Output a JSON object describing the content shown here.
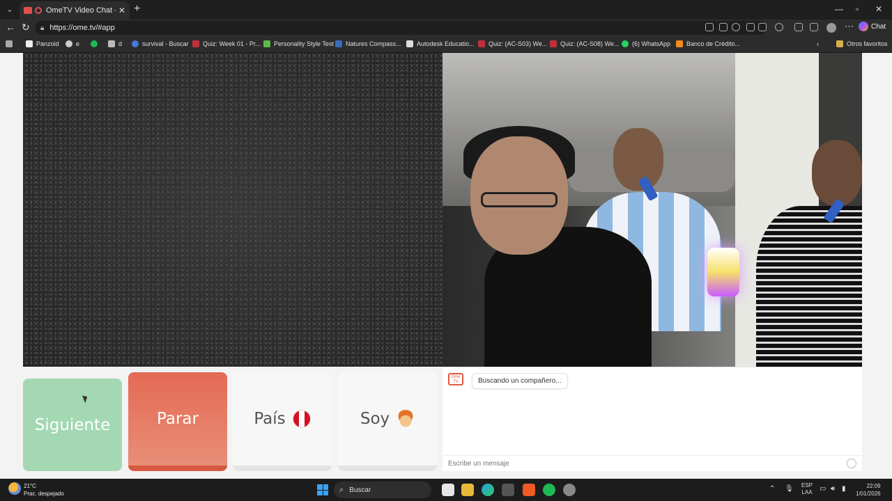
{
  "browser": {
    "tab_title": "OmeTV Video Chat — Omegle",
    "url": "https://ome.tv/#app",
    "chat_label": "Chat",
    "bookmarks": [
      {
        "label": "Panzoid"
      },
      {
        "label": "e"
      },
      {
        "label": ""
      },
      {
        "label": "d"
      },
      {
        "label": "survival - Buscar"
      },
      {
        "label": "Quiz: Week 01 - Pr..."
      },
      {
        "label": "Personality Style Test"
      },
      {
        "label": "Natures Compass..."
      },
      {
        "label": "Autodesk Educatio..."
      },
      {
        "label": "Quiz: (AC-S03) We..."
      },
      {
        "label": "Quiz: (AC-S08) We..."
      },
      {
        "label": "(6) WhatsApp"
      },
      {
        "label": "Banco de Crédito..."
      }
    ],
    "other_favorites": "Otros favoritos"
  },
  "controls": {
    "next": "Siguiente",
    "stop": "Parar",
    "country": "País",
    "me": "Soy"
  },
  "chat": {
    "logo_top": "Ome",
    "logo_bottom": "TV",
    "status": "Buscando un compañero...",
    "input_placeholder": "Escribe un mensaje"
  },
  "taskbar": {
    "temperature": "21°C",
    "weather": "Prac. despejado",
    "search": "Buscar",
    "lang_top": "ESP",
    "lang_bottom": "LAA",
    "time": "22:09",
    "date": "1/01/2026"
  }
}
